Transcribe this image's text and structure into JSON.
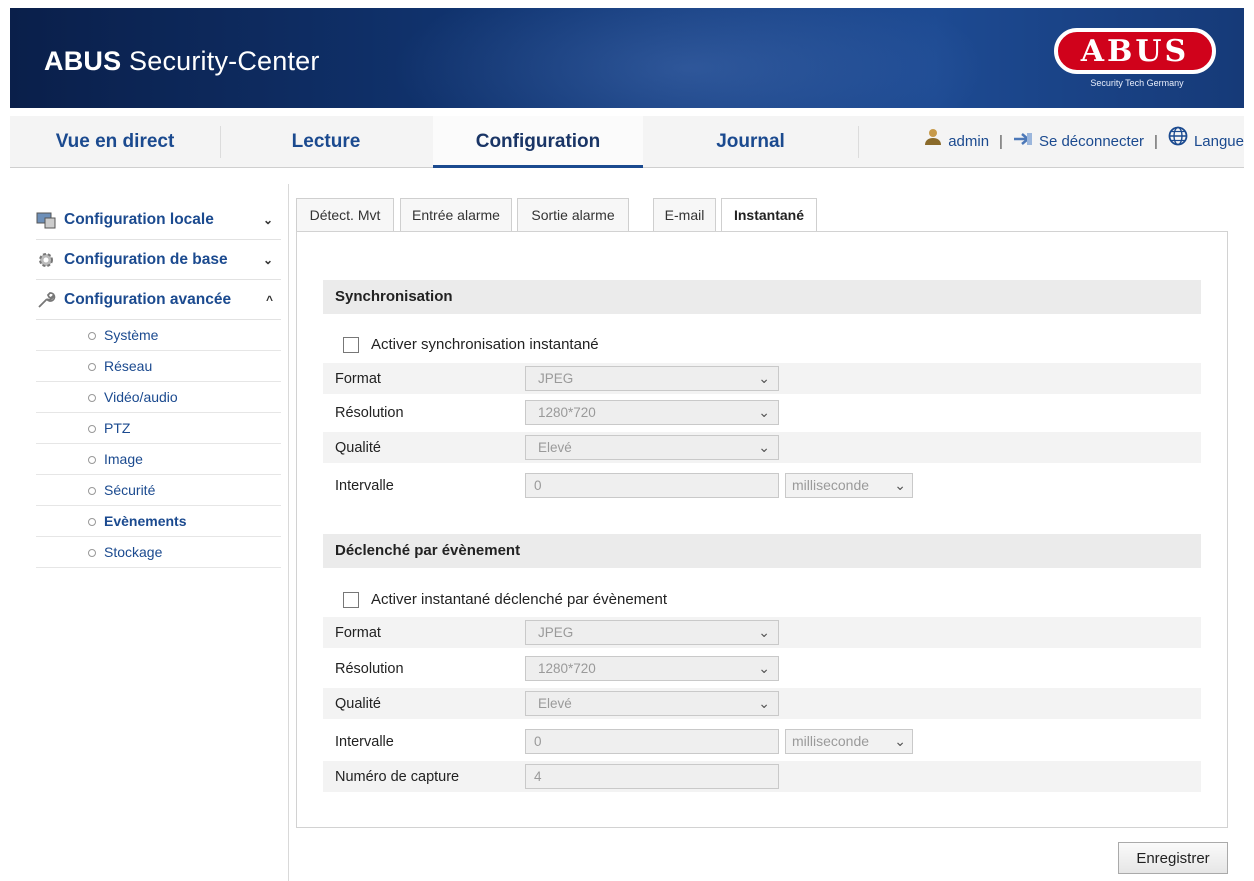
{
  "header": {
    "app_title_bold": "ABUS",
    "app_title_rest": " Security-Center",
    "logo_text": "ABUS",
    "logo_tagline": "Security Tech Germany"
  },
  "nav": {
    "tabs": [
      "Vue en direct",
      "Lecture",
      "Configuration",
      "Journal"
    ],
    "active_tab": "Configuration",
    "user": "admin",
    "logout": "Se déconnecter",
    "language": "Langue",
    "separator": "|"
  },
  "sidebar": {
    "groups": [
      {
        "label": "Configuration locale",
        "icon": "computer-icon",
        "chevron": "⌄"
      },
      {
        "label": "Configuration de base",
        "icon": "gear-icon",
        "chevron": "⌄"
      },
      {
        "label": "Configuration avancée",
        "icon": "wrench-icon",
        "chevron": "^"
      }
    ],
    "items": [
      "Système",
      "Réseau",
      "Vidéo/audio",
      "PTZ",
      "Image",
      "Sécurité",
      "Evènements",
      "Stockage"
    ],
    "active_item": "Evènements"
  },
  "subtabs": [
    "Détect. Mvt",
    "Entrée alarme",
    "Sortie alarme",
    "E-mail",
    "Instantané"
  ],
  "active_subtab": "Instantané",
  "sync": {
    "heading": "Synchronisation",
    "checkbox_label": "Activer synchronisation instantané",
    "format_label": "Format",
    "format_value": "JPEG",
    "resolution_label": "Résolution",
    "resolution_value": "1280*720",
    "quality_label": "Qualité",
    "quality_value": "Elevé",
    "interval_label": "Intervalle",
    "interval_value": "0",
    "interval_unit": "milliseconde"
  },
  "event": {
    "heading": "Déclenché par évènement",
    "checkbox_label": "Activer instantané déclenché par évènement",
    "format_label": "Format",
    "format_value": "JPEG",
    "resolution_label": "Résolution",
    "resolution_value": "1280*720",
    "quality_label": "Qualité",
    "quality_value": "Elevé",
    "interval_label": "Intervalle",
    "interval_value": "0",
    "interval_unit": "milliseconde",
    "capture_label": "Numéro de capture",
    "capture_value": "4"
  },
  "save_label": "Enregistrer",
  "colors": {
    "brand_blue": "#1b4a8f",
    "banner_dark": "#0a1f4a",
    "logo_red": "#d0021b"
  }
}
